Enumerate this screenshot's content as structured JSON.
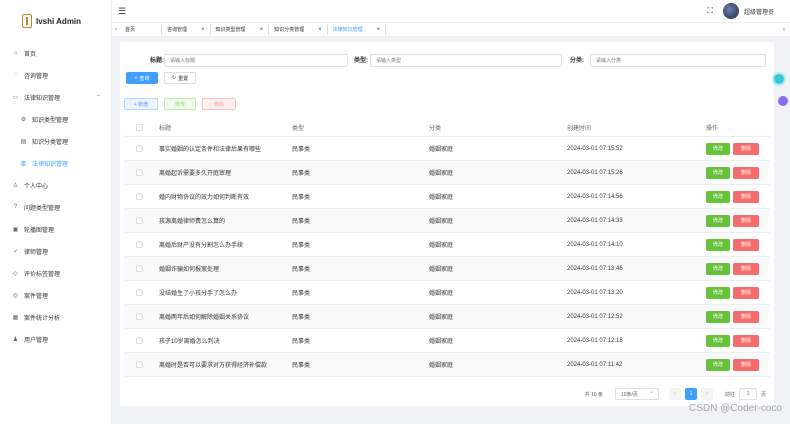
{
  "app": {
    "title": "lvshi Admin"
  },
  "header": {
    "user_name": "超级管理员"
  },
  "sidebar": {
    "items": [
      {
        "label": "首页",
        "icon": "home-icon"
      },
      {
        "label": "咨询管理",
        "icon": "chat-icon"
      },
      {
        "label": "法律知识管理",
        "icon": "monitor-icon",
        "expanded": true
      },
      {
        "label": "知识类型管理",
        "icon": "gear-icon",
        "sub": true
      },
      {
        "label": "知识分类管理",
        "icon": "document-icon",
        "sub": true
      },
      {
        "label": "法律知识管理",
        "icon": "folder-icon",
        "sub": true,
        "active": true
      },
      {
        "label": "个人中心",
        "icon": "user-icon"
      },
      {
        "label": "问题类型管理",
        "icon": "help-icon"
      },
      {
        "label": "轮播图管理",
        "icon": "image-icon"
      },
      {
        "label": "律师管理",
        "icon": "check-icon"
      },
      {
        "label": "评价标签管理",
        "icon": "tag-icon"
      },
      {
        "label": "案件管理",
        "icon": "case-icon"
      },
      {
        "label": "案件统计分析",
        "icon": "chart-icon"
      },
      {
        "label": "用户管理",
        "icon": "users-icon"
      }
    ]
  },
  "tabs": [
    {
      "label": "首页",
      "closable": false
    },
    {
      "label": "咨询管理",
      "closable": true
    },
    {
      "label": "知识类型管理",
      "closable": true
    },
    {
      "label": "知识分类管理",
      "closable": true
    },
    {
      "label": "法律知识管理",
      "closable": true,
      "active": true
    }
  ],
  "filters": {
    "title_label": "标题:",
    "title_placeholder": "请输入标题",
    "type_label": "类型:",
    "type_placeholder": "请输入类型",
    "category_label": "分类:",
    "category_placeholder": "请输入分类",
    "search_button": "查询",
    "reset_button": "重置"
  },
  "toolbar": {
    "add_label": "+ 新增",
    "edit_label": "修改",
    "delete_label": "删除"
  },
  "table": {
    "headers": {
      "title": "标题",
      "type": "类型",
      "category": "分类",
      "created": "创建时间",
      "ops": "操作"
    },
    "edit_label": "修改",
    "delete_label": "删除",
    "rows": [
      {
        "title": "事实婚姻的认定条件和法律后果有哪些",
        "type": "民事类",
        "category": "婚姻家庭",
        "created": "2024-03-01 07:15:52"
      },
      {
        "title": "离婚起诉需要多久开庭审理",
        "type": "民事类",
        "category": "婚姻家庭",
        "created": "2024-03-01 07:15:26"
      },
      {
        "title": "婚内财物协议的效力如何判断有效",
        "type": "民事类",
        "category": "婚姻家庭",
        "created": "2024-03-01 07:14:56"
      },
      {
        "title": "孩源离婚律师费怎么算的",
        "type": "民事类",
        "category": "婚姻家庭",
        "created": "2024-03-01 07:14:33"
      },
      {
        "title": "离婚后财产没有分割怎么办手续",
        "type": "民事类",
        "category": "婚姻家庭",
        "created": "2024-03-01 07:14:10"
      },
      {
        "title": "婚姻诈骗如何报案处理",
        "type": "民事类",
        "category": "婚姻家庭",
        "created": "2024-03-01 07:13:46"
      },
      {
        "title": "没结婚生了小孩分手了怎么办",
        "type": "民事类",
        "category": "婚姻家庭",
        "created": "2024-03-01 07:13:20"
      },
      {
        "title": "离婚两年后如何解除婚姻关系协议",
        "type": "民事类",
        "category": "婚姻家庭",
        "created": "2024-03-01 07:12:52"
      },
      {
        "title": "孩子10岁离婚怎么判决",
        "type": "民事类",
        "category": "婚姻家庭",
        "created": "2024-03-01 07:12:18"
      },
      {
        "title": "离婚时是否可以要求对方获得经济补偿款",
        "type": "民事类",
        "category": "婚姻家庭",
        "created": "2024-03-01 07:11:42"
      }
    ]
  },
  "pagination": {
    "total": "共 10 条",
    "page_size": "10条/页",
    "prev": "‹",
    "current": "1",
    "next": "›",
    "goto_label": "前往",
    "goto_value": "1",
    "page_unit": "页"
  },
  "watermark": "CSDN @Coder-coco",
  "colors": {
    "primary": "#409eff",
    "success": "#67c23a",
    "danger": "#f56c6c"
  }
}
